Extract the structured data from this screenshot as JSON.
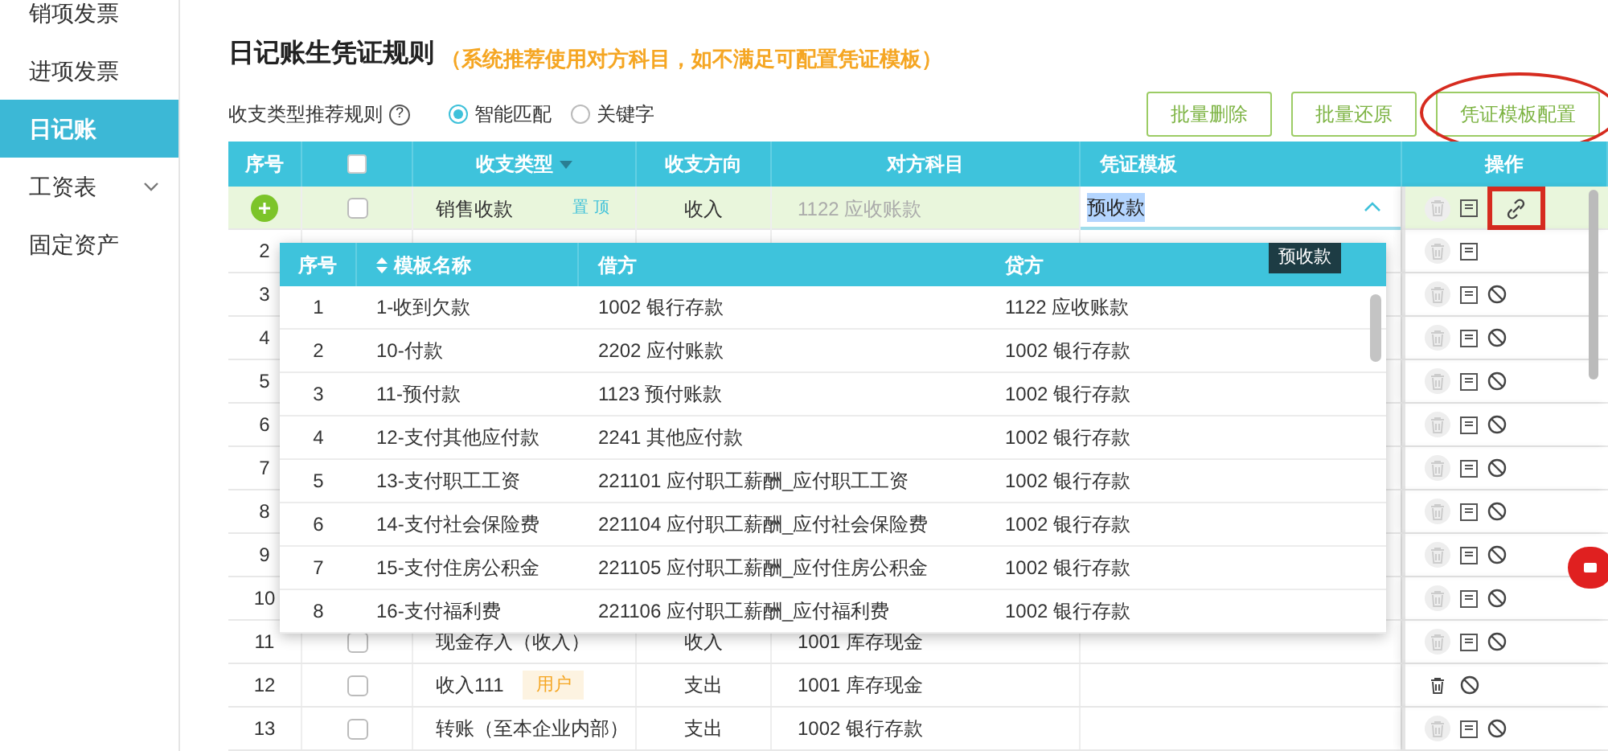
{
  "sidebar": {
    "items": [
      {
        "label": "销项发票",
        "selected": false
      },
      {
        "label": "进项发票",
        "selected": false
      },
      {
        "label": "日记账",
        "selected": true
      },
      {
        "label": "工资表",
        "selected": false,
        "expandable": true
      },
      {
        "label": "固定资产",
        "selected": false
      }
    ]
  },
  "title": "日记账生凭证规则",
  "title_note": "（系统推荐使用对方科目，如不满足可配置凭证模板）",
  "rule": {
    "label": "收支类型推荐规则",
    "help": "?",
    "options": [
      {
        "label": "智能匹配",
        "selected": true
      },
      {
        "label": "关键字",
        "selected": false
      }
    ]
  },
  "buttons": [
    {
      "label": "批量删除",
      "highlighted": false
    },
    {
      "label": "批量还原",
      "highlighted": false
    },
    {
      "label": "凭证模板配置",
      "highlighted": true
    }
  ],
  "table": {
    "select_all_checked": false,
    "columns": [
      "序号",
      "",
      "收支类型",
      "收支方向",
      "对方科目",
      "凭证模板",
      "操作"
    ],
    "rows": [
      {
        "kind": "editing",
        "selected": true,
        "checked": false,
        "type": "销售收款",
        "pin_link": "置 顶",
        "direction": "收入",
        "account": "1122 应收账款",
        "template": "预收款",
        "expanded": true,
        "actions": [
          {
            "kind": "delete",
            "disabled": true
          },
          {
            "kind": "edit"
          },
          {
            "kind": "link",
            "highlighted": true
          }
        ]
      },
      {
        "kind": "row",
        "selected": false,
        "seq": "2",
        "actions": [
          {
            "kind": "delete",
            "disabled": true
          },
          {
            "kind": "edit"
          }
        ]
      },
      {
        "kind": "row",
        "selected": false,
        "seq": "3",
        "actions": [
          {
            "kind": "delete",
            "disabled": true
          },
          {
            "kind": "edit"
          },
          {
            "kind": "ban"
          }
        ]
      },
      {
        "kind": "row",
        "selected": false,
        "seq": "4",
        "actions": [
          {
            "kind": "delete",
            "disabled": true
          },
          {
            "kind": "edit"
          },
          {
            "kind": "ban"
          }
        ]
      },
      {
        "kind": "row",
        "selected": false,
        "seq": "5",
        "actions": [
          {
            "kind": "delete",
            "disabled": true
          },
          {
            "kind": "edit"
          },
          {
            "kind": "ban"
          }
        ]
      },
      {
        "kind": "row",
        "selected": false,
        "seq": "6",
        "actions": [
          {
            "kind": "delete",
            "disabled": true
          },
          {
            "kind": "edit"
          },
          {
            "kind": "ban"
          }
        ]
      },
      {
        "kind": "row",
        "selected": false,
        "seq": "7",
        "actions": [
          {
            "kind": "delete",
            "disabled": true
          },
          {
            "kind": "edit"
          },
          {
            "kind": "ban"
          }
        ]
      },
      {
        "kind": "row",
        "selected": false,
        "seq": "8",
        "actions": [
          {
            "kind": "delete",
            "disabled": true
          },
          {
            "kind": "edit"
          },
          {
            "kind": "ban"
          }
        ]
      },
      {
        "kind": "row",
        "selected": false,
        "seq": "9",
        "actions": [
          {
            "kind": "delete",
            "disabled": true
          },
          {
            "kind": "edit"
          },
          {
            "kind": "ban"
          }
        ]
      },
      {
        "kind": "row",
        "selected": false,
        "seq": "10",
        "actions": [
          {
            "kind": "delete",
            "disabled": true
          },
          {
            "kind": "edit"
          },
          {
            "kind": "ban"
          }
        ]
      },
      {
        "kind": "row",
        "selected": false,
        "seq": "11",
        "checked": false,
        "type": "现金存入（收入）",
        "direction": "收入",
        "account": "1001 库存现金",
        "actions": [
          {
            "kind": "delete",
            "disabled": true
          },
          {
            "kind": "edit"
          },
          {
            "kind": "ban"
          }
        ]
      },
      {
        "kind": "row",
        "selected": false,
        "seq": "12",
        "checked": false,
        "type": "收入111",
        "tag": "用户",
        "direction": "支出",
        "account": "1001 库存现金",
        "actions": [
          {
            "kind": "delete",
            "disabled": false
          },
          {
            "kind": "ban"
          }
        ]
      },
      {
        "kind": "row",
        "selected": false,
        "seq": "13",
        "checked": false,
        "type": "转账（至本企业内部）",
        "direction": "支出",
        "account": "1002 银行存款",
        "actions": [
          {
            "kind": "delete",
            "disabled": true
          },
          {
            "kind": "edit"
          },
          {
            "kind": "ban"
          }
        ]
      }
    ]
  },
  "dropdown": {
    "tooltip": "预收款",
    "columns": [
      "序号",
      "模板名称",
      "借方",
      "贷方"
    ],
    "rows": [
      [
        "1",
        "1-收到欠款",
        "1002 银行存款",
        "1122 应收账款"
      ],
      [
        "2",
        "10-付款",
        "2202 应付账款",
        "1002 银行存款"
      ],
      [
        "3",
        "11-预付款",
        "1123 预付账款",
        "1002 银行存款"
      ],
      [
        "4",
        "12-支付其他应付款",
        "2241 其他应付款",
        "1002 银行存款"
      ],
      [
        "5",
        "13-支付职工工资",
        "221101 应付职工薪酬_应付职工工资",
        "1002 银行存款"
      ],
      [
        "6",
        "14-支付社会保险费",
        "221104 应付职工薪酬_应付社会保险费",
        "1002 银行存款"
      ],
      [
        "7",
        "15-支付住房公积金",
        "221105 应付职工薪酬_应付住房公积金",
        "1002 银行存款"
      ],
      [
        "8",
        "16-支付福利费",
        "221106 应付职工薪酬_应付福利费",
        "1002 银行存款"
      ]
    ]
  }
}
